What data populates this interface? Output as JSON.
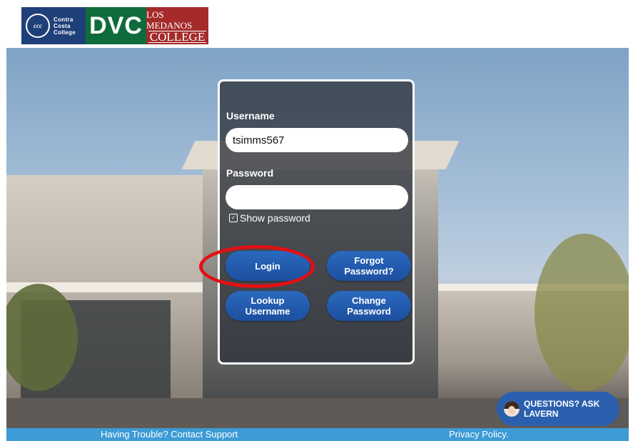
{
  "header": {
    "ccc_logo": {
      "seal": "ccc",
      "lines": [
        "Contra",
        "Costa",
        "College"
      ]
    },
    "dvc_logo": "DVC",
    "lmc_logo": {
      "line1": "LOS MEDANOS",
      "line2": "COLLEGE"
    }
  },
  "login": {
    "username_label": "Username",
    "username_value": "tsimms567",
    "password_label": "Password",
    "password_value": "",
    "show_password_label": "Show password",
    "login_button": "Login",
    "forgot_password_button": "Forgot Password?",
    "lookup_username_button": "Lookup Username",
    "change_password_button": "Change Password"
  },
  "chat": {
    "label": "QUESTIONS? ASK LAVERN",
    "icon": "avatar-icon"
  },
  "footer": {
    "support_link": "Having Trouble? Contact Support",
    "privacy_link": "Privacy Policy."
  },
  "colors": {
    "button_blue": "#1d4f9e",
    "footer_blue": "#3d9bd6",
    "highlight_red": "#e30f14",
    "ccc_blue": "#1f3f78",
    "dvc_green": "#0f6b3c",
    "lmc_red": "#a52a2a"
  }
}
